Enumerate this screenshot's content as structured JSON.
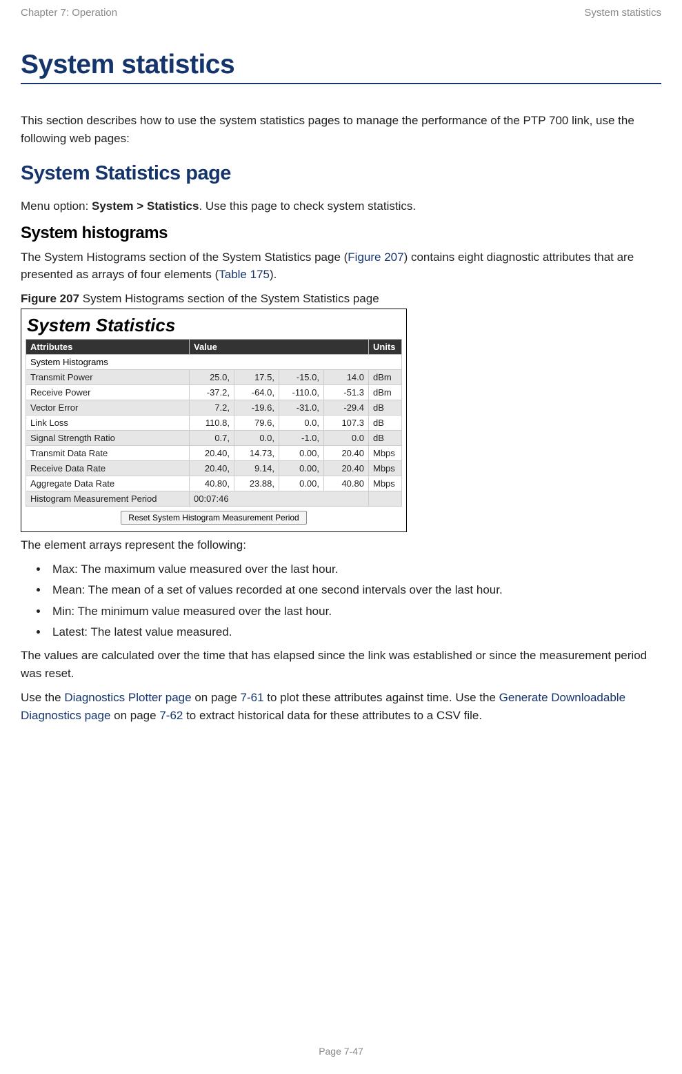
{
  "header": {
    "left": "Chapter 7:  Operation",
    "right": "System statistics"
  },
  "title": "System statistics",
  "intro": "This section describes how to use the system statistics pages to manage the performance of the PTP 700 link, use the following web pages:",
  "section_h2": "System Statistics page",
  "menu_line_pre": "Menu option: ",
  "menu_line_bold": "System > Statistics",
  "menu_line_post": ". Use this page to check system statistics.",
  "subsection_h3": "System histograms",
  "hist_para_1a": "The System Histograms section of the System Statistics page (",
  "hist_link1": "Figure 207",
  "hist_para_1b": ") contains eight diagnostic attributes that are presented as arrays of four elements (",
  "hist_link2": "Table 175",
  "hist_para_1c": ").",
  "figure_caption_bold": "Figure 207",
  "figure_caption_rest": " System Histograms section of the System Statistics page",
  "figure": {
    "title": "System Statistics",
    "col_attr": "Attributes",
    "col_val": "Value",
    "col_units": "Units",
    "subheader": "System Histograms",
    "rows": [
      {
        "attr": "Transmit Power",
        "v": [
          "25.0,",
          "17.5,",
          "-15.0,",
          "14.0"
        ],
        "units": "dBm"
      },
      {
        "attr": "Receive Power",
        "v": [
          "-37.2,",
          "-64.0,",
          "-110.0,",
          "-51.3"
        ],
        "units": "dBm"
      },
      {
        "attr": "Vector Error",
        "v": [
          "7.2,",
          "-19.6,",
          "-31.0,",
          "-29.4"
        ],
        "units": "dB"
      },
      {
        "attr": "Link Loss",
        "v": [
          "110.8,",
          "79.6,",
          "0.0,",
          "107.3"
        ],
        "units": "dB"
      },
      {
        "attr": "Signal Strength Ratio",
        "v": [
          "0.7,",
          "0.0,",
          "-1.0,",
          "0.0"
        ],
        "units": "dB"
      },
      {
        "attr": "Transmit Data Rate",
        "v": [
          "20.40,",
          "14.73,",
          "0.00,",
          "20.40"
        ],
        "units": "Mbps"
      },
      {
        "attr": "Receive Data Rate",
        "v": [
          "20.40,",
          "9.14,",
          "0.00,",
          "20.40"
        ],
        "units": "Mbps"
      },
      {
        "attr": "Aggregate Data Rate",
        "v": [
          "40.80,",
          "23.88,",
          "0.00,",
          "40.80"
        ],
        "units": "Mbps"
      }
    ],
    "period_label": "Histogram Measurement Period",
    "period_value": "00:07:46",
    "reset_button": "Reset System Histogram Measurement Period"
  },
  "list_intro": "The element arrays represent the following:",
  "bullets": [
    "Max: The maximum value measured over the last hour.",
    "Mean: The mean of a set of values recorded at one second intervals over the last hour.",
    "Min: The minimum value measured over the last hour.",
    "Latest: The latest value measured."
  ],
  "after_list": "The values are calculated over the time that has elapsed since the link was established or since the measurement period was reset.",
  "final_para": {
    "a": "Use the ",
    "link1": "Diagnostics Plotter page",
    "b": " on page ",
    "page1": "7-61",
    "c": " to plot these attributes against time. Use the ",
    "link2": "Generate Downloadable Diagnostics page",
    "d": " on page ",
    "page2": "7-62",
    "e": " to extract historical data for these attributes to a CSV file."
  },
  "footer": "Page 7-47"
}
